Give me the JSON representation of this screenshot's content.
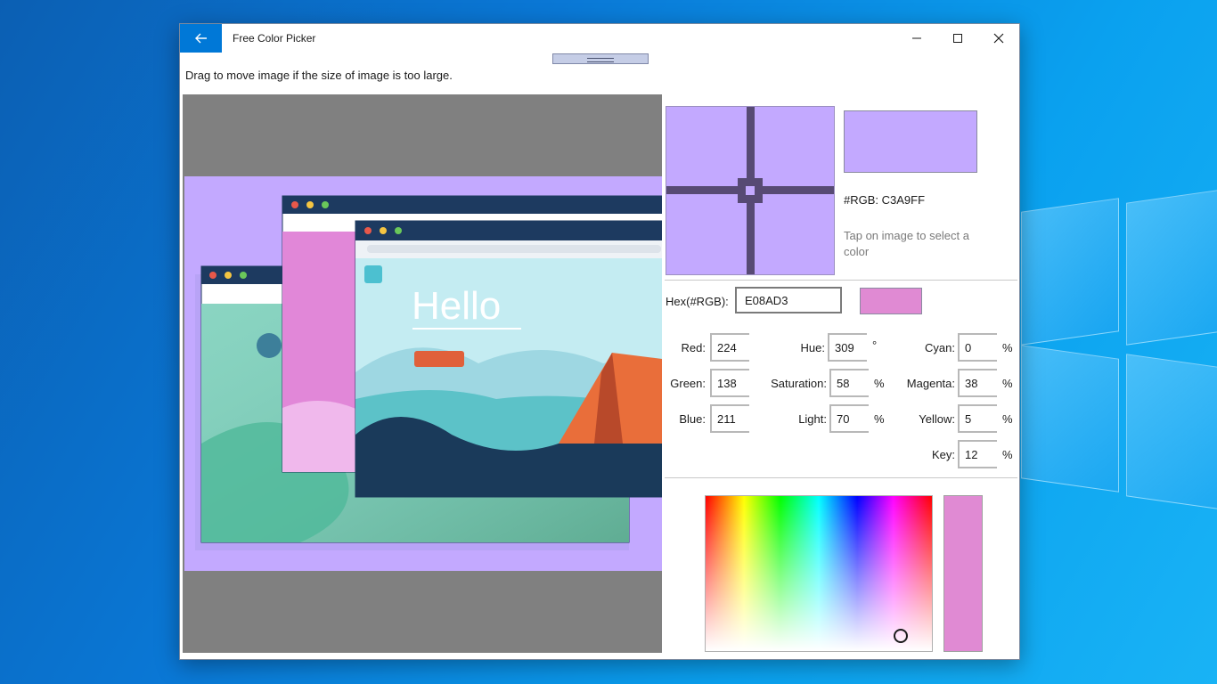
{
  "window": {
    "title": "Free Color Picker",
    "controls": {
      "minimize": "minimize-icon",
      "maximize": "maximize-icon",
      "close": "close-icon"
    }
  },
  "hint_text": "Drag to move image if the size of image is too large.",
  "image_panel": {
    "hello_text": "Hello"
  },
  "picker": {
    "rgb_label": "#RGB: C3A9FF",
    "tap_hint": "Tap on image to select a color",
    "sampled_color": "#c3a9ff"
  },
  "hex": {
    "label": "Hex(#RGB):",
    "value": "E08AD3",
    "color": "#e08ad3"
  },
  "rgb": {
    "red_label": "Red:",
    "red": "224",
    "green_label": "Green:",
    "green": "138",
    "blue_label": "Blue:",
    "blue": "211"
  },
  "hsl": {
    "hue_label": "Hue:",
    "hue": "309",
    "hue_unit": "°",
    "sat_label": "Saturation:",
    "sat": "58",
    "sat_unit": "%",
    "light_label": "Light:",
    "light": "70",
    "light_unit": "%"
  },
  "cmyk": {
    "cyan_label": "Cyan:",
    "cyan": "0",
    "magenta_label": "Magenta:",
    "magenta": "38",
    "yellow_label": "Yellow:",
    "yellow": "5",
    "key_label": "Key:",
    "key": "12",
    "unit": "%"
  }
}
